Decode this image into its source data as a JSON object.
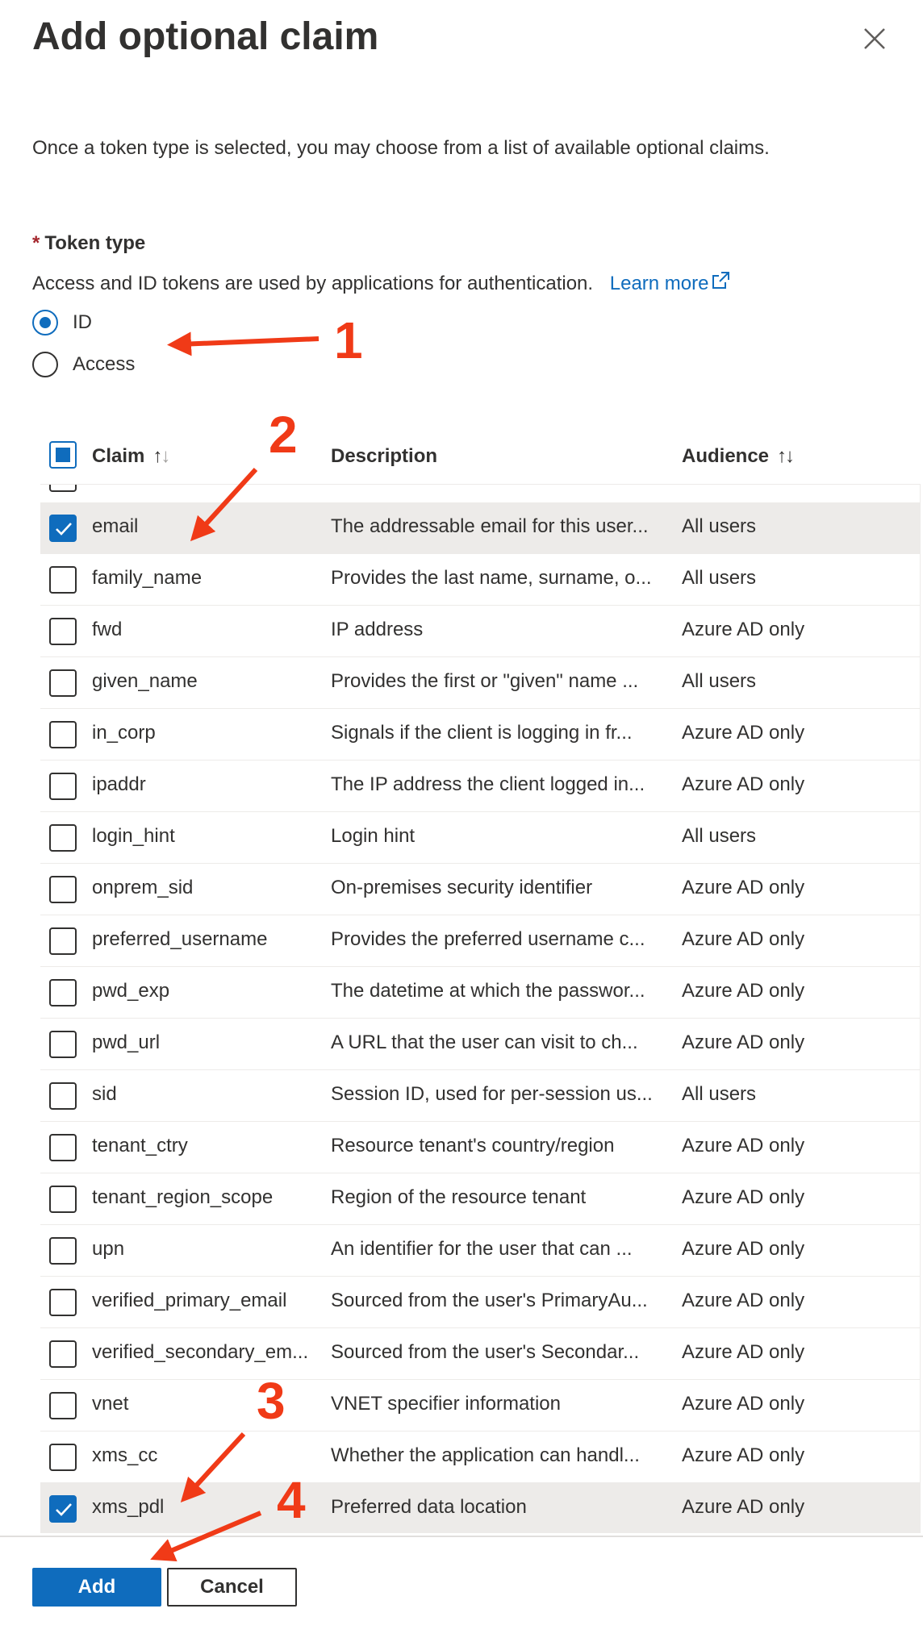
{
  "panel": {
    "title": "Add optional claim",
    "intro": "Once a token type is selected, you may choose from a list of available optional claims.",
    "token_type": {
      "required_mark": "*",
      "label": "Token type",
      "helper": "Access and ID tokens are used by applications for authentication.",
      "learn_more": "Learn more",
      "options": [
        {
          "label": "ID",
          "selected": true
        },
        {
          "label": "Access",
          "selected": false
        }
      ]
    },
    "table": {
      "headers": {
        "claim": "Claim",
        "description": "Description",
        "audience": "Audience"
      },
      "rows": [
        {
          "claim": "email",
          "description": "The addressable email for this user...",
          "audience": "All users",
          "checked": true
        },
        {
          "claim": "family_name",
          "description": "Provides the last name, surname, o...",
          "audience": "All users",
          "checked": false
        },
        {
          "claim": "fwd",
          "description": "IP address",
          "audience": "Azure AD only",
          "checked": false
        },
        {
          "claim": "given_name",
          "description": "Provides the first or \"given\" name ...",
          "audience": "All users",
          "checked": false
        },
        {
          "claim": "in_corp",
          "description": "Signals if the client is logging in fr...",
          "audience": "Azure AD only",
          "checked": false
        },
        {
          "claim": "ipaddr",
          "description": "The IP address the client logged in...",
          "audience": "Azure AD only",
          "checked": false
        },
        {
          "claim": "login_hint",
          "description": "Login hint",
          "audience": "All users",
          "checked": false
        },
        {
          "claim": "onprem_sid",
          "description": "On-premises security identifier",
          "audience": "Azure AD only",
          "checked": false
        },
        {
          "claim": "preferred_username",
          "description": "Provides the preferred username c...",
          "audience": "Azure AD only",
          "checked": false
        },
        {
          "claim": "pwd_exp",
          "description": "The datetime at which the passwor...",
          "audience": "Azure AD only",
          "checked": false
        },
        {
          "claim": "pwd_url",
          "description": "A URL that the user can visit to ch...",
          "audience": "Azure AD only",
          "checked": false
        },
        {
          "claim": "sid",
          "description": "Session ID, used for per-session us...",
          "audience": "All users",
          "checked": false
        },
        {
          "claim": "tenant_ctry",
          "description": "Resource tenant's country/region",
          "audience": "Azure AD only",
          "checked": false
        },
        {
          "claim": "tenant_region_scope",
          "description": "Region of the resource tenant",
          "audience": "Azure AD only",
          "checked": false
        },
        {
          "claim": "upn",
          "description": "An identifier for the user that can ...",
          "audience": "Azure AD only",
          "checked": false
        },
        {
          "claim": "verified_primary_email",
          "description": "Sourced from the user's PrimaryAu...",
          "audience": "Azure AD only",
          "checked": false
        },
        {
          "claim": "verified_secondary_em...",
          "description": "Sourced from the user's Secondar...",
          "audience": "Azure AD only",
          "checked": false
        },
        {
          "claim": "vnet",
          "description": "VNET specifier information",
          "audience": "Azure AD only",
          "checked": false
        },
        {
          "claim": "xms_cc",
          "description": "Whether the application can handl...",
          "audience": "Azure AD only",
          "checked": false
        },
        {
          "claim": "xms_pdl",
          "description": "Preferred data location",
          "audience": "Azure AD only",
          "checked": true
        }
      ]
    },
    "buttons": {
      "add": "Add",
      "cancel": "Cancel"
    }
  },
  "annotations": [
    "1",
    "2",
    "3",
    "4"
  ],
  "colors": {
    "accent": "#0f6cbd",
    "annotation": "#f03a17",
    "selected_row": "#edebe9"
  },
  "icons": {
    "close": "close-icon",
    "external": "external-link-icon",
    "sort": "sort-arrows-icon",
    "check": "checkmark-icon"
  }
}
